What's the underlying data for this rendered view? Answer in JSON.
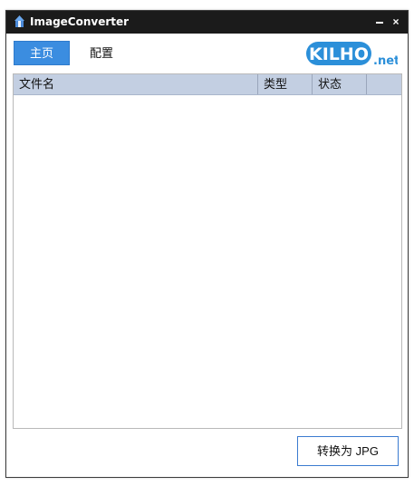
{
  "window": {
    "title": "ImageConverter",
    "minimize_icon": "minimize-icon",
    "close_icon": "close-icon",
    "close_glyph": "×"
  },
  "tabs": [
    {
      "label": "主页",
      "selected": true
    },
    {
      "label": "配置",
      "selected": false
    }
  ],
  "logo": {
    "text": "KILHO",
    "suffix": ".net",
    "color": "#2b8fd9"
  },
  "file_table": {
    "columns": [
      "文件名",
      "类型",
      "状态"
    ],
    "rows": []
  },
  "actions": {
    "convert_label": "转换为 JPG"
  },
  "colors": {
    "titlebar": "#1b1b1b",
    "accent": "#3b8de0",
    "header": "#c3cfe2"
  }
}
